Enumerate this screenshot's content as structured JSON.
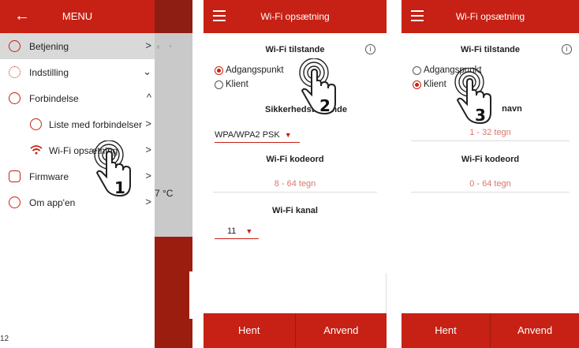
{
  "screen1": {
    "header": {
      "back_icon": "arrow-left-icon",
      "title": "MENU"
    },
    "menu": [
      {
        "label": "Betjening",
        "icon": "home-icon",
        "chevron": ">"
      },
      {
        "label": "Indstilling",
        "icon": "settings-icon",
        "chevron": "⌄"
      },
      {
        "label": "Forbindelse",
        "icon": "share-icon",
        "chevron": "^"
      },
      {
        "label": "Liste med forbindelser",
        "icon": "list-icon",
        "chevron": ">"
      },
      {
        "label": "Wi-Fi opsætning",
        "icon": "wifi-icon",
        "chevron": ">"
      },
      {
        "label": "Firmware",
        "icon": "firmware-icon",
        "chevron": ">"
      },
      {
        "label": "Om app'en",
        "icon": "info-icon",
        "chevron": ">"
      }
    ],
    "background_temp": "7 °C",
    "step": "1"
  },
  "screen2": {
    "title": "Wi-Fi opsætning",
    "section_mode": "Wi-Fi tilstande",
    "radio_ap": "Adgangspunkt",
    "radio_client": "Klient",
    "security_label": "Sikkerhedstilstande",
    "security_value": "WPA/WPA2 PSK",
    "password_label": "Wi-Fi kodeord",
    "password_hint": "8 - 64 tegn",
    "channel_label": "Wi-Fi kanal",
    "channel_value": "11",
    "btn_fetch": "Hent",
    "btn_apply": "Anvend",
    "step": "2"
  },
  "screen3": {
    "title": "Wi-Fi opsætning",
    "section_mode": "Wi-Fi tilstande",
    "radio_ap": "Adgangspunkt",
    "radio_client": "Klient",
    "name_label": "navn",
    "name_hint": "1 - 32 tegn",
    "password_label": "Wi-Fi kodeord",
    "password_hint": "0 - 64 tegn",
    "btn_fetch": "Hent",
    "btn_apply": "Anvend",
    "step": "3"
  },
  "page_number": "12",
  "colors": {
    "brand_red": "#c62114",
    "hint_red": "#d8776c",
    "active_gray": "#d9d9d9"
  }
}
